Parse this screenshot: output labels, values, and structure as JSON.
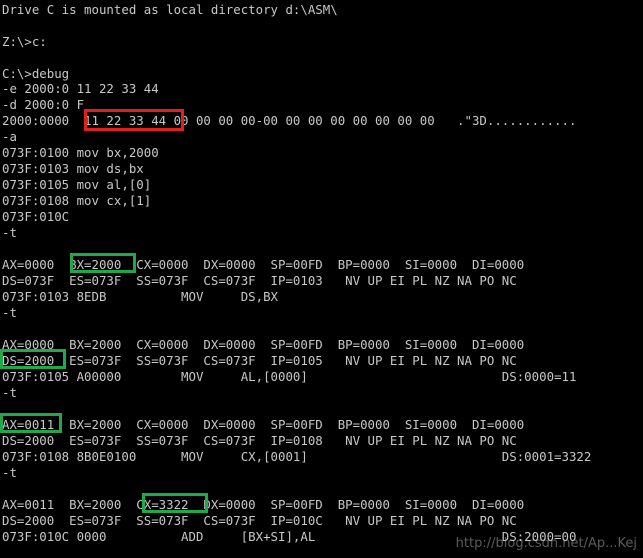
{
  "terminal": {
    "lines": [
      "Drive C is mounted as local directory d:\\ASM\\",
      "",
      "Z:\\>c:",
      "",
      "C:\\>debug",
      "-e 2000:0 11 22 33 44",
      "-d 2000:0 F",
      "2000:0000  11 22 33 44 00 00 00 00-00 00 00 00 00 00 00 00   .\"3D............",
      "-a",
      "073F:0100 mov bx,2000",
      "073F:0103 mov ds,bx",
      "073F:0105 mov al,[0]",
      "073F:0108 mov cx,[1]",
      "073F:010C",
      "-t",
      "",
      "AX=0000  BX=2000  CX=0000  DX=0000  SP=00FD  BP=0000  SI=0000  DI=0000",
      "DS=073F  ES=073F  SS=073F  CS=073F  IP=0103   NV UP EI PL NZ NA PO NC",
      "073F:0103 8EDB          MOV     DS,BX",
      "-t",
      "",
      "AX=0000  BX=2000  CX=0000  DX=0000  SP=00FD  BP=0000  SI=0000  DI=0000",
      "DS=2000  ES=073F  SS=073F  CS=073F  IP=0105   NV UP EI PL NZ NA PO NC",
      "073F:0105 A00000        MOV     AL,[0000]                          DS:0000=11",
      "-t",
      "",
      "AX=0011  BX=2000  CX=0000  DX=0000  SP=00FD  BP=0000  SI=0000  DI=0000",
      "DS=2000  ES=073F  SS=073F  CS=073F  IP=0108   NV UP EI PL NZ NA PO NC",
      "073F:0108 8B0E0100      MOV     CX,[0001]                          DS:0001=3322",
      "-t",
      "",
      "AX=0011  BX=2000  CX=3322  DX=0000  SP=00FD  BP=0000  SI=0000  DI=0000",
      "DS=2000  ES=073F  SS=073F  CS=073F  IP=010C   NV UP EI PL NZ NA PO NC",
      "073F:010C 0000          ADD     [BX+SI],AL                         DS:2000=00"
    ],
    "watermark": "http://blog.csdn.net/Ap...Kej"
  },
  "highlights": {
    "red": "#e02020",
    "green": "#22a84a"
  }
}
